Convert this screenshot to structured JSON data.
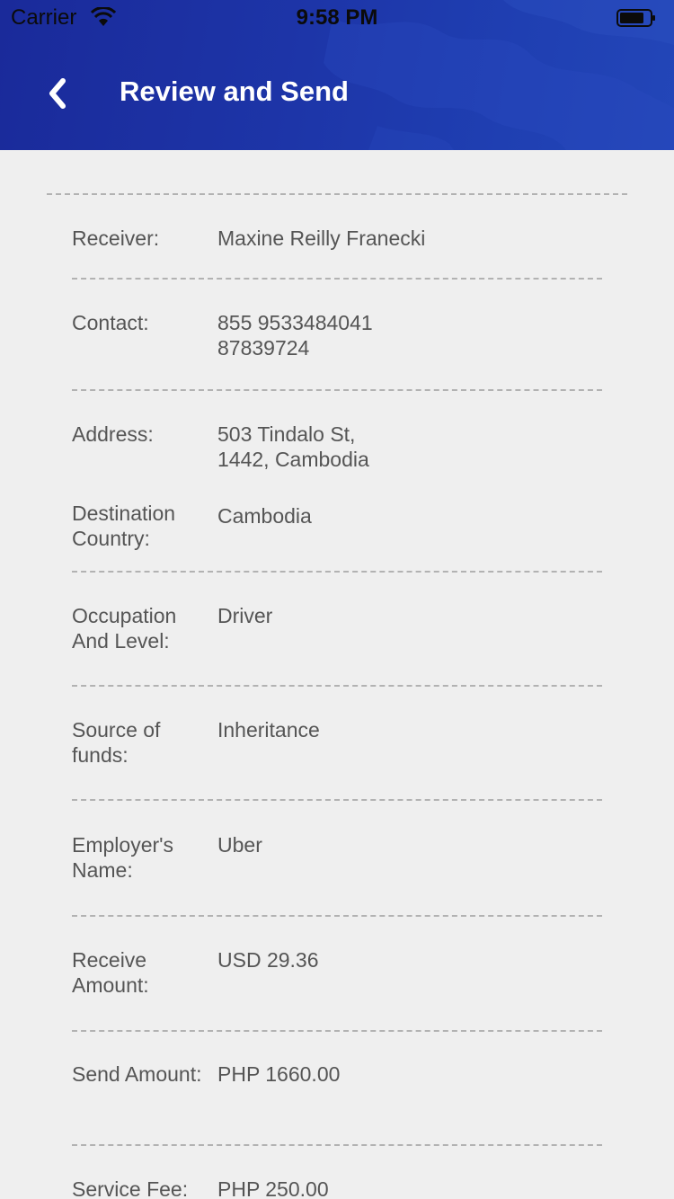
{
  "status_bar": {
    "carrier": "Carrier",
    "time": "9:58 PM"
  },
  "header": {
    "title": "Review and Send",
    "back_icon": "chevron-left-icon"
  },
  "details": [
    {
      "label": "Receiver:",
      "value_lines": [
        "Maxine Reilly Franecki"
      ]
    },
    {
      "label": "Contact:",
      "value_lines": [
        "855 9533484041",
        "87839724"
      ]
    },
    {
      "label": "Address:",
      "value_lines": [
        "503 Tindalo St,",
        "1442, Cambodia"
      ]
    },
    {
      "label": "Destination Country:",
      "value_lines": [
        "Cambodia"
      ]
    },
    {
      "label": "Occupation And Level:",
      "value_lines": [
        "Driver"
      ]
    },
    {
      "label": "Source of funds:",
      "value_lines": [
        "Inheritance"
      ]
    },
    {
      "label": "Employer's Name:",
      "value_lines": [
        "Uber"
      ]
    },
    {
      "label": "Receive Amount:",
      "value_lines": [
        "USD 29.36"
      ]
    },
    {
      "label": "Send Amount:",
      "value_lines": [
        "PHP 1660.00"
      ]
    },
    {
      "label": "Service Fee:",
      "value_lines": [
        "PHP 250.00"
      ]
    }
  ],
  "colors": {
    "header_blue": "#1d35a8",
    "background": "#efefef",
    "text_gray": "#555555",
    "divider": "#b2b2b2"
  }
}
